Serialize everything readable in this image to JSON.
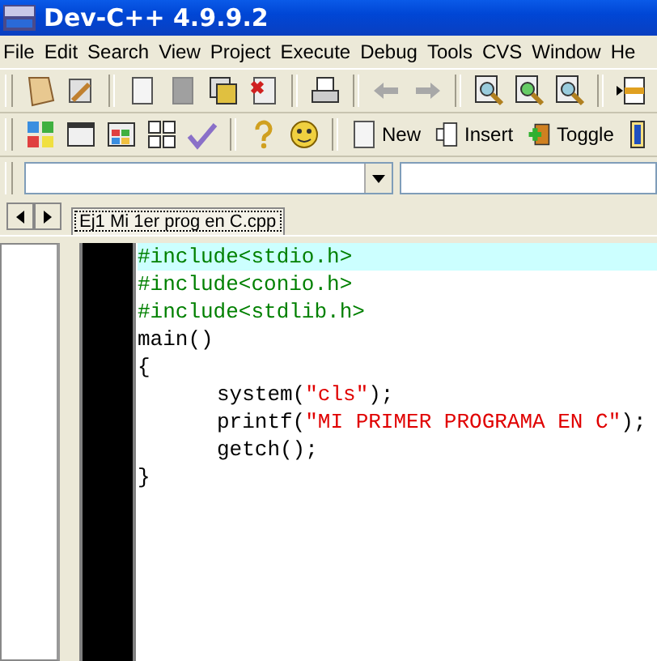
{
  "window": {
    "title": "Dev-C++ 4.9.9.2"
  },
  "menu": [
    "File",
    "Edit",
    "Search",
    "View",
    "Project",
    "Execute",
    "Debug",
    "Tools",
    "CVS",
    "Window",
    "He"
  ],
  "toolbar_buttons": [
    "New",
    "Insert",
    "Toggle"
  ],
  "editor_tabs": [
    {
      "label": "Ej1 Mi 1er prog en C.cpp",
      "selected": true
    }
  ],
  "code_lines": [
    {
      "highlighted": true,
      "indented": false,
      "segments": [
        {
          "kind": "preprocessor",
          "text": "#include<stdio.h>"
        }
      ]
    },
    {
      "highlighted": false,
      "indented": false,
      "segments": [
        {
          "kind": "preprocessor",
          "text": "#include<conio.h>"
        }
      ]
    },
    {
      "highlighted": false,
      "indented": false,
      "segments": [
        {
          "kind": "preprocessor",
          "text": "#include<stdlib.h>"
        }
      ]
    },
    {
      "highlighted": false,
      "indented": false,
      "segments": [
        {
          "kind": "plain",
          "text": "main()"
        }
      ]
    },
    {
      "highlighted": false,
      "indented": false,
      "segments": [
        {
          "kind": "plain",
          "text": "{"
        }
      ]
    },
    {
      "highlighted": false,
      "indented": true,
      "segments": [
        {
          "kind": "plain",
          "text": "system("
        },
        {
          "kind": "string",
          "text": "\"cls\""
        },
        {
          "kind": "plain",
          "text": ");"
        }
      ]
    },
    {
      "highlighted": false,
      "indented": true,
      "segments": [
        {
          "kind": "plain",
          "text": "printf("
        },
        {
          "kind": "string",
          "text": "\"MI PRIMER PROGRAMA EN C\""
        },
        {
          "kind": "plain",
          "text": ");"
        }
      ]
    },
    {
      "highlighted": false,
      "indented": true,
      "segments": [
        {
          "kind": "plain",
          "text": "getch();"
        }
      ]
    },
    {
      "highlighted": false,
      "indented": false,
      "segments": [
        {
          "kind": "plain",
          "text": "}"
        }
      ]
    }
  ]
}
